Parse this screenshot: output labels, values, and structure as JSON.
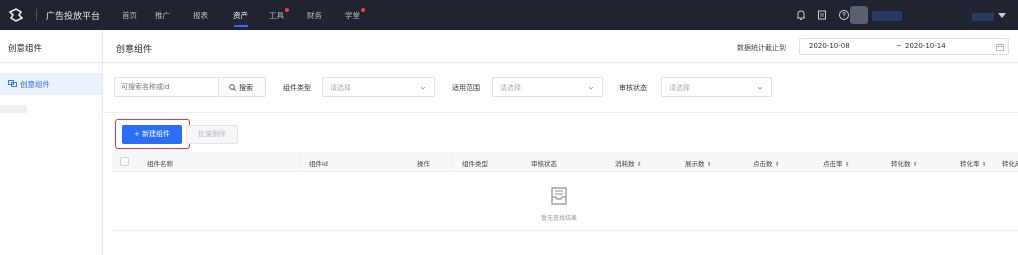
{
  "topbar": {
    "app_title": "广告投放平台",
    "nav": [
      "首页",
      "推广",
      "报表",
      "资产",
      "工具",
      "财务",
      "学堂"
    ],
    "active_nav": "资产",
    "icons": [
      "bell-icon",
      "document-icon",
      "help-icon",
      "avatar"
    ],
    "accent": "#2b6ef5"
  },
  "subbar": {
    "left_title": "创意组件",
    "page_title": "创意组件",
    "date_label": "数据统计截止到",
    "date_start": "2020-10-08",
    "date_sep": "~",
    "date_end": "2020-10-14"
  },
  "sidebar": {
    "items": [
      {
        "label": "创意组件",
        "icon": "component-icon"
      }
    ]
  },
  "filters": {
    "search_placeholder": "可搜索名称或id",
    "search_button": "搜索",
    "component_type_label": "组件类型",
    "component_type_placeholder": "请选择",
    "scope_label": "适用范围",
    "scope_placeholder": "请选择",
    "review_label": "审核状态",
    "review_placeholder": "请选择"
  },
  "actions": {
    "new_button": "+ 新建组件",
    "batch_delete": "批量删除"
  },
  "table": {
    "columns": [
      "组件名称",
      "组件id",
      "操作",
      "组件类型",
      "审核状态",
      "消耗数",
      "展示数",
      "点击数",
      "点击率",
      "转化数",
      "转化率",
      "转化成"
    ],
    "empty_text": "暂无查找结果"
  }
}
